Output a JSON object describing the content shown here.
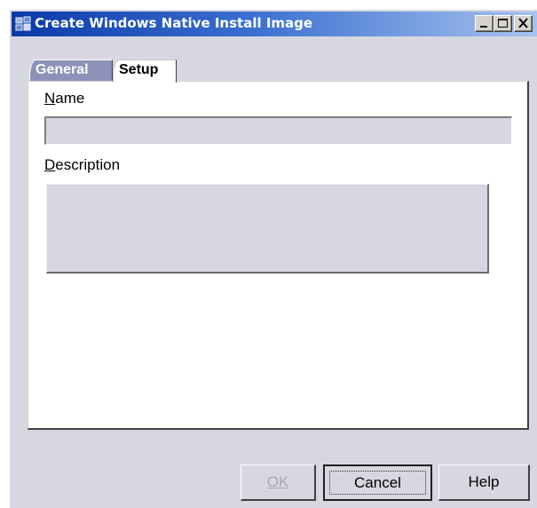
{
  "window": {
    "title": "Create Windows Native Install Image",
    "icon": "app-icon",
    "controls": {
      "minimize": "minimize-icon",
      "maximize": "maximize-icon",
      "close": "close-icon"
    }
  },
  "tabs": [
    {
      "label": "General",
      "selected": false
    },
    {
      "label": "Setup",
      "selected": true
    }
  ],
  "form": {
    "name_label": "Name",
    "name_value": "",
    "description_label": "Description",
    "description_value": ""
  },
  "buttons": {
    "ok": "OK",
    "ok_enabled": false,
    "cancel": "Cancel",
    "help": "Help"
  },
  "colors": {
    "title_start": "#0a3aa8",
    "title_end": "#a6c2ee",
    "dialog_bg": "#d6d7e0",
    "tab_inactive": "#8c92b8"
  }
}
